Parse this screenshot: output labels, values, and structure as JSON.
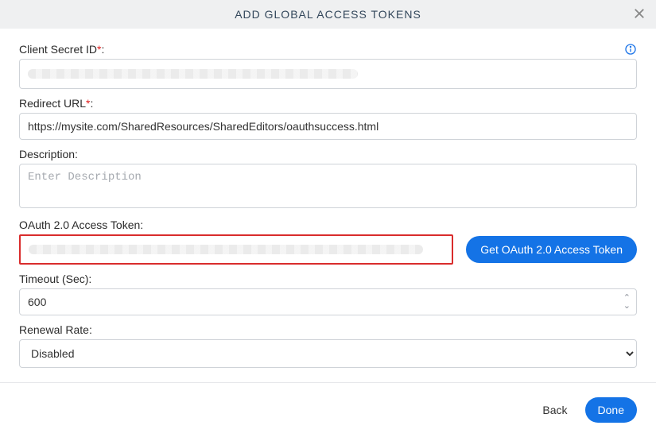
{
  "header": {
    "title": "ADD GLOBAL ACCESS TOKENS"
  },
  "fields": {
    "clientSecret": {
      "label": "Client Secret ID",
      "required": "*",
      "value": ""
    },
    "redirectUrl": {
      "label": "Redirect URL",
      "required": "*",
      "value": "https://mysite.com/SharedResources/SharedEditors/oauthsuccess.html"
    },
    "description": {
      "label": "Description:",
      "placeholder": "Enter Description",
      "value": ""
    },
    "accessToken": {
      "label": "OAuth 2.0 Access Token:",
      "value": ""
    },
    "timeout": {
      "label": "Timeout (Sec):",
      "value": "600"
    },
    "renewalRate": {
      "label": "Renewal Rate:",
      "value": "Disabled",
      "options": [
        "Disabled"
      ]
    }
  },
  "buttons": {
    "getToken": "Get OAuth 2.0 Access Token",
    "back": "Back",
    "done": "Done"
  }
}
